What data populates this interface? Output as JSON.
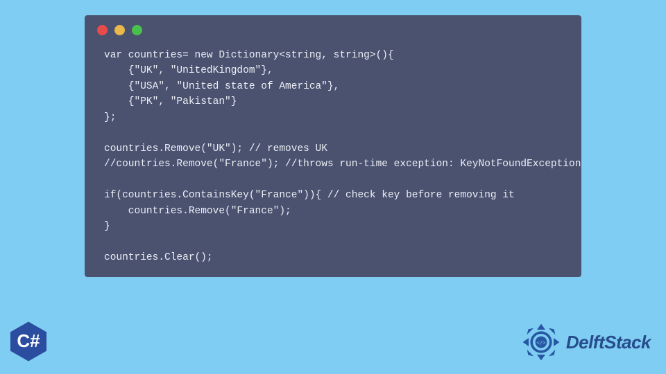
{
  "code": {
    "lines": [
      "var countries= new Dictionary<string, string>(){",
      "    {\"UK\", \"UnitedKingdom\"},",
      "    {\"USA\", \"United state of America\"},",
      "    {\"PK\", \"Pakistan\"}",
      "};",
      "",
      "countries.Remove(\"UK\"); // removes UK",
      "//countries.Remove(\"France\"); //throws run-time exception: KeyNotFoundException",
      "",
      "if(countries.ContainsKey(\"France\")){ // check key before removing it",
      "    countries.Remove(\"France\");",
      "}",
      "",
      "countries.Clear();"
    ]
  },
  "csharp_badge": "C#",
  "brand": {
    "name": "DelftStack"
  }
}
